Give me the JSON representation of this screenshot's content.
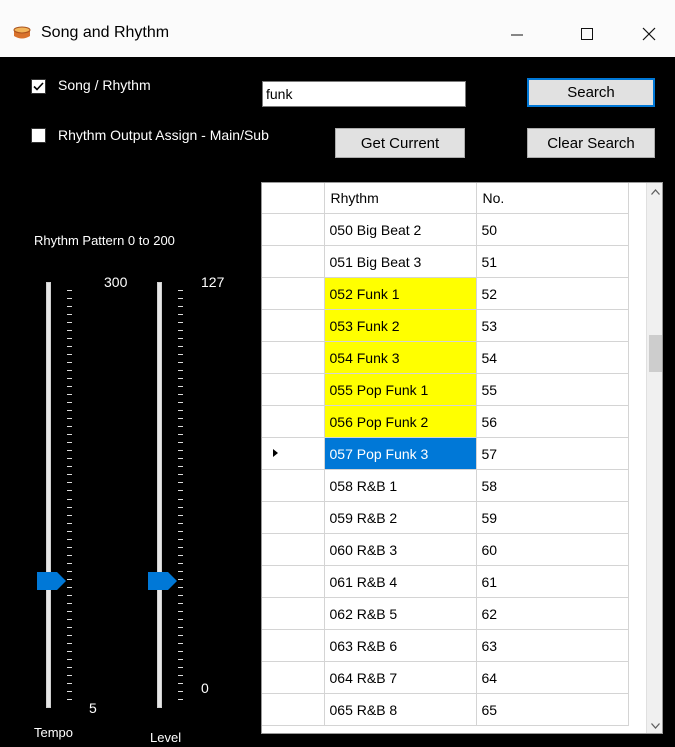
{
  "window": {
    "title": "Song and Rhythm"
  },
  "controls": {
    "song_rhythm_label": "Song / Rhythm",
    "song_rhythm_checked": true,
    "output_assign_label": "Rhythm Output Assign - Main/Sub",
    "output_assign_checked": false,
    "search_value": "funk",
    "search_button": "Search",
    "get_current_button": "Get Current",
    "clear_search_button": "Clear Search",
    "pattern_range_label": "Rhythm Pattern 0 to 200"
  },
  "sliders": {
    "tempo": {
      "label": "Tempo",
      "max_label": "300",
      "min_label": "5",
      "value_fraction": 0.29
    },
    "level": {
      "label": "Level",
      "max_label": "127",
      "min_label": "0",
      "value_fraction": 0.29
    }
  },
  "grid": {
    "columns": [
      "Rhythm",
      "No."
    ],
    "rows": [
      {
        "rhythm": "050 Big Beat 2",
        "no": "50",
        "state": ""
      },
      {
        "rhythm": "051 Big Beat 3",
        "no": "51",
        "state": ""
      },
      {
        "rhythm": "052 Funk 1",
        "no": "52",
        "state": "highlight"
      },
      {
        "rhythm": "053 Funk 2",
        "no": "53",
        "state": "highlight"
      },
      {
        "rhythm": "054 Funk 3",
        "no": "54",
        "state": "highlight"
      },
      {
        "rhythm": "055 Pop Funk 1",
        "no": "55",
        "state": "highlight"
      },
      {
        "rhythm": "056 Pop Funk 2",
        "no": "56",
        "state": "highlight"
      },
      {
        "rhythm": "057 Pop Funk 3",
        "no": "57",
        "state": "selected"
      },
      {
        "rhythm": "058 R&B 1",
        "no": "58",
        "state": ""
      },
      {
        "rhythm": "059 R&B 2",
        "no": "59",
        "state": ""
      },
      {
        "rhythm": "060 R&B 3",
        "no": "60",
        "state": ""
      },
      {
        "rhythm": "061 R&B 4",
        "no": "61",
        "state": ""
      },
      {
        "rhythm": "062 R&B 5",
        "no": "62",
        "state": ""
      },
      {
        "rhythm": "063 R&B 6",
        "no": "63",
        "state": ""
      },
      {
        "rhythm": "064 R&B 7",
        "no": "64",
        "state": ""
      },
      {
        "rhythm": "065 R&B 8",
        "no": "65",
        "state": ""
      }
    ]
  },
  "colors": {
    "highlight": "#ffff00",
    "selected": "#0078d7",
    "thumb": "#0078d7"
  },
  "icons": {
    "app": "drum-icon",
    "row_pointer": "row-pointer-icon"
  }
}
